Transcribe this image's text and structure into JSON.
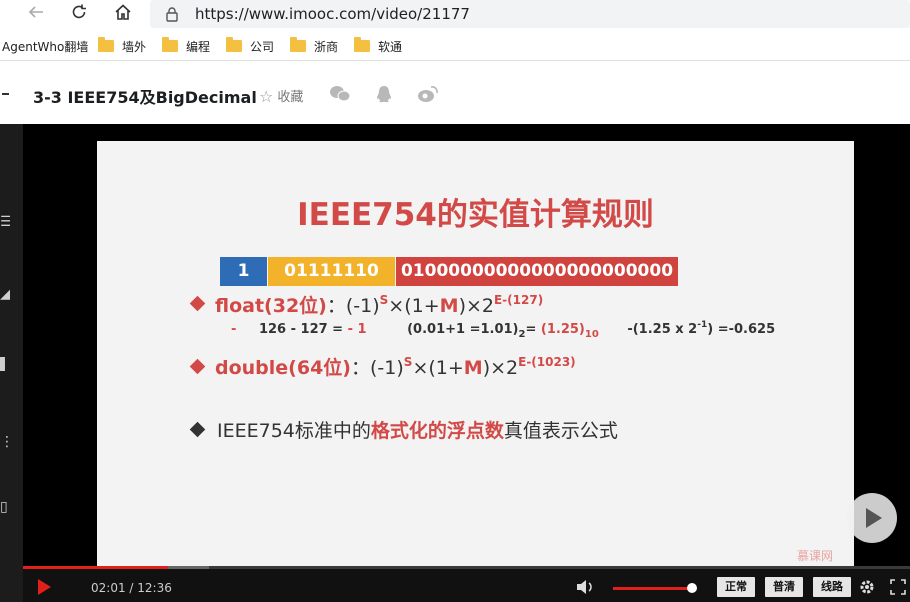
{
  "browser": {
    "url": "https://www.imooc.com/video/21177",
    "bookmarks": [
      "AgentWho翻墙",
      "墙外",
      "编程",
      "公司",
      "浙商",
      "软通"
    ]
  },
  "header": {
    "title": "3-3 IEEE754及BigDecimal",
    "favorite_label": "收藏"
  },
  "slide": {
    "title": "IEEE754的实值计算规则",
    "bits": {
      "sign": "1",
      "exponent": "01111110",
      "mantissa": "01000000000000000000000"
    },
    "float_label": "float(32位)",
    "float_formula_a": "：(-1)",
    "float_formula_s": "S",
    "float_formula_b": "×(1+",
    "float_formula_m": "M",
    "float_formula_c": ")×2",
    "float_formula_exp": "E-(127)",
    "calc_dash": "-",
    "calc_exp": "126 - 127 =",
    "calc_exp_result": "- 1",
    "calc_mant": "(0.01+1 =1.01)",
    "calc_mant_sub": "2",
    "calc_mant_eq": "=",
    "calc_mant_result": "(1.25)",
    "calc_mant_result_sub": "10",
    "calc_final_a": "-(1.25 x 2",
    "calc_final_exp": "-1",
    "calc_final_b": ") =-0.625",
    "double_label": "double(64位)",
    "double_formula_a": "：(-1)",
    "double_formula_s": "S",
    "double_formula_b": "×(1+",
    "double_formula_m": "M",
    "double_formula_c": ")×2",
    "double_formula_exp": "E-(1023)",
    "note_a": "IEEE754标准中的",
    "note_highlight": "格式化的浮点数",
    "note_b": "真值表示公式",
    "logo": "慕课网"
  },
  "player": {
    "time": "02:01 / 12:36",
    "progress": 0.16,
    "volume": 0.95,
    "quality_buttons": [
      "正常",
      "普清",
      "线路"
    ]
  },
  "colors": {
    "accent_red": "#d24a47",
    "player_red": "#e0201a",
    "sign_blue": "#2e6db5",
    "exponent_yellow": "#f2b22a",
    "mantissa_red": "#d0433f"
  }
}
